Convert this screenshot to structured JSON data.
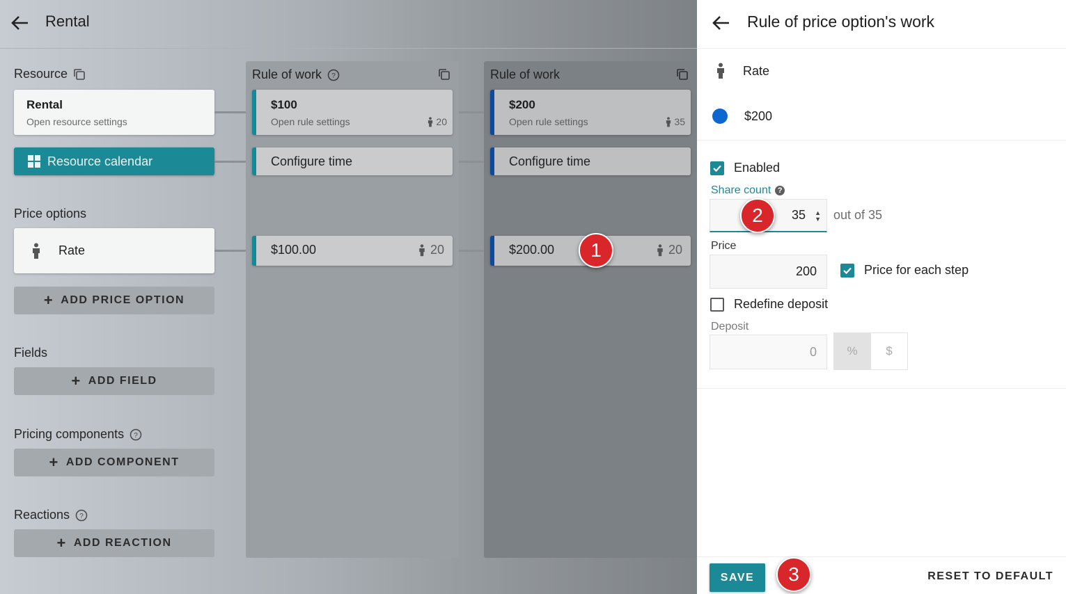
{
  "app": {
    "title": "Rental",
    "resource_label": "Resource",
    "resource_card": {
      "title": "Rental",
      "subtitle": "Open resource settings"
    },
    "calendar_button": "Resource calendar",
    "price_options_label": "Price options",
    "price_option_card": {
      "label": "Rate"
    },
    "add_price_option": "ADD PRICE OPTION",
    "fields_label": "Fields",
    "add_field": "ADD FIELD",
    "pricing_components_label": "Pricing components",
    "add_component": "ADD COMPONENT",
    "reactions_label": "Reactions",
    "add_reaction": "ADD REACTION"
  },
  "columns": [
    {
      "title": "Rule of work",
      "rule_title": "$100",
      "rule_sub": "Open rule settings",
      "rule_count": "20",
      "configure": "Configure time",
      "price": "$100.00",
      "price_count": "20"
    },
    {
      "title": "Rule of work",
      "rule_title": "$200",
      "rule_sub": "Open rule settings",
      "rule_count": "35",
      "configure": "Configure time",
      "price": "$200.00",
      "price_count": "20"
    }
  ],
  "markers": [
    "1",
    "2",
    "3"
  ],
  "panel": {
    "title": "Rule of price option's work",
    "rate_label": "Rate",
    "rule_label": "$200",
    "enabled_label": "Enabled",
    "share_count_label": "Share count",
    "share_count_value": "35",
    "out_of": "out of 35",
    "price_label": "Price",
    "price_value": "200",
    "price_each_step_label": "Price for each step",
    "redefine_deposit_label": "Redefine deposit",
    "deposit_label": "Deposit",
    "deposit_value": "0",
    "unit_percent": "%",
    "unit_dollar": "$",
    "save": "SAVE",
    "reset": "RESET TO DEFAULT"
  },
  "colors": {
    "accent": "#1b8a96",
    "rule_blue": "#0d4a9c",
    "marker_red": "#d8262a",
    "dot_blue": "#0e66d0"
  },
  "icons": [
    "back-arrow-icon",
    "copy-icon",
    "help-icon",
    "grid-icon",
    "person-icon",
    "plus-icon",
    "check-icon",
    "spinner-icon"
  ]
}
